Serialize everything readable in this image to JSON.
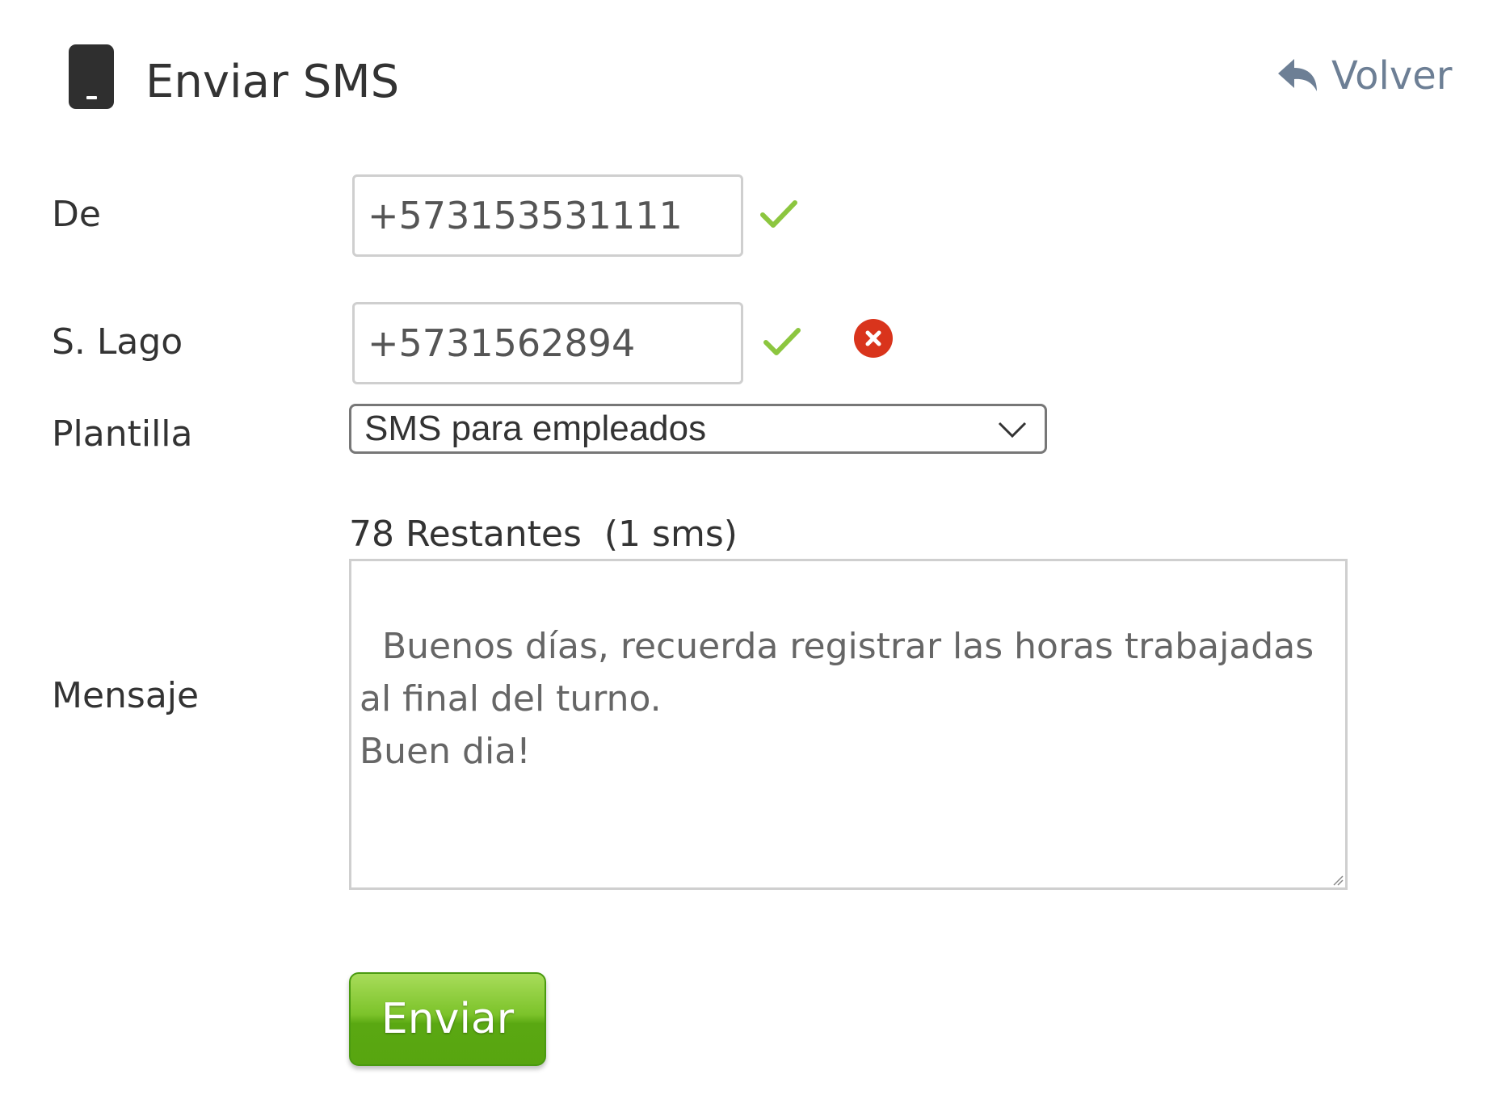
{
  "header": {
    "title": "Enviar SMS",
    "back_label": "Volver",
    "icons": {
      "title_icon": "phone-icon",
      "back_icon": "reply-arrow-icon"
    }
  },
  "form": {
    "from": {
      "label": "De",
      "value": "+573153531111",
      "status_icon": "check-icon"
    },
    "recipient": {
      "label": "S. Lago",
      "value": "+5731562894",
      "status_icon": "check-icon",
      "remove_icon": "remove-icon"
    },
    "template": {
      "label": "Plantilla",
      "selected": "SMS para empleados"
    },
    "message": {
      "label": "Mensaje",
      "counter": "78 Restantes  (1 sms)",
      "text": "Buenos días, recuerda registrar las horas trabajadas\nal final del turno.\nBuen dia!"
    },
    "submit_label": "Enviar"
  },
  "colors": {
    "check": "#8cc63f",
    "remove": "#d9341c",
    "back_link": "#6d7f95",
    "button_green": "#5aa812",
    "text": "#333333"
  }
}
